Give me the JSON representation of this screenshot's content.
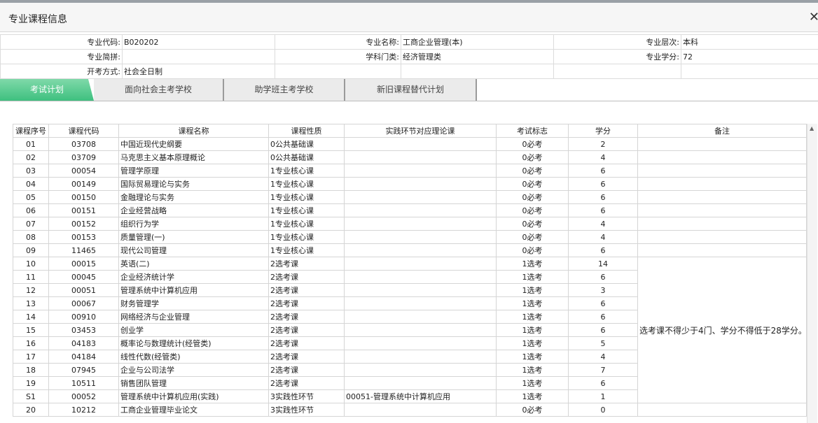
{
  "window": {
    "title": "专业课程信息"
  },
  "info": {
    "code_label": "专业代码:",
    "code": "B020202",
    "name_label": "专业名称:",
    "name": "工商企业管理(本)",
    "level_label": "专业层次:",
    "level": "本科",
    "abbr_label": "专业简拼:",
    "abbr": "",
    "category_label": "学科门类:",
    "category": "经济管理类",
    "credits_label": "专业学分:",
    "credits": "72",
    "mode_label": "开考方式:",
    "mode": "社会全日制"
  },
  "tabs": [
    "考试计划",
    "面向社会主考学校",
    "助学班主考学校",
    "新旧课程替代计划"
  ],
  "table": {
    "headers": [
      "课程序号",
      "课程代码",
      "课程名称",
      "课程性质",
      "实践环节对应理论课",
      "考试标志",
      "学分",
      "备注"
    ],
    "rows": [
      [
        "01",
        "03708",
        "中国近现代史纲要",
        "0公共基础课",
        "",
        "0必考",
        "2"
      ],
      [
        "02",
        "03709",
        "马克思主义基本原理概论",
        "0公共基础课",
        "",
        "0必考",
        "4"
      ],
      [
        "03",
        "00054",
        "管理学原理",
        "1专业核心课",
        "",
        "0必考",
        "6"
      ],
      [
        "04",
        "00149",
        "国际贸易理论与实务",
        "1专业核心课",
        "",
        "0必考",
        "6"
      ],
      [
        "05",
        "00150",
        "金融理论与实务",
        "1专业核心课",
        "",
        "0必考",
        "6"
      ],
      [
        "06",
        "00151",
        "企业经营战略",
        "1专业核心课",
        "",
        "0必考",
        "6"
      ],
      [
        "07",
        "00152",
        "组织行为学",
        "1专业核心课",
        "",
        "0必考",
        "4"
      ],
      [
        "08",
        "00153",
        "质量管理(一)",
        "1专业核心课",
        "",
        "0必考",
        "4"
      ],
      [
        "09",
        "11465",
        "现代公司管理",
        "1专业核心课",
        "",
        "0必考",
        "6"
      ],
      [
        "10",
        "00015",
        "英语(二)",
        "2选考课",
        "",
        "1选考",
        "14"
      ],
      [
        "11",
        "00045",
        "企业经济统计学",
        "2选考课",
        "",
        "1选考",
        "6"
      ],
      [
        "12",
        "00051",
        "管理系统中计算机应用",
        "2选考课",
        "",
        "1选考",
        "3"
      ],
      [
        "13",
        "00067",
        "财务管理学",
        "2选考课",
        "",
        "1选考",
        "6"
      ],
      [
        "14",
        "00910",
        "网络经济与企业管理",
        "2选考课",
        "",
        "1选考",
        "6"
      ],
      [
        "15",
        "03453",
        "创业学",
        "2选考课",
        "",
        "1选考",
        "6"
      ],
      [
        "16",
        "04183",
        "概率论与数理统计(经管类)",
        "2选考课",
        "",
        "1选考",
        "5"
      ],
      [
        "17",
        "04184",
        "线性代数(经管类)",
        "2选考课",
        "",
        "1选考",
        "4"
      ],
      [
        "18",
        "07945",
        "企业与公司法学",
        "2选考课",
        "",
        "1选考",
        "7"
      ],
      [
        "19",
        "10511",
        "销售团队管理",
        "2选考课",
        "",
        "1选考",
        "6"
      ],
      [
        "S1",
        "00052",
        "管理系统中计算机应用(实践)",
        "3实践性环节",
        "00051-管理系统中计算机应用",
        "1选考",
        "1"
      ],
      [
        "20",
        "10212",
        "工商企业管理毕业论文",
        "3实践性环节",
        "",
        "0必考",
        "0"
      ]
    ],
    "note": "选考课不得少于4门、学分不得低于28学分。"
  }
}
